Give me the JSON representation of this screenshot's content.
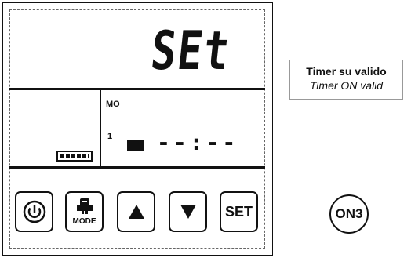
{
  "display": {
    "main_segment_text": "SEt",
    "mode_label": "MO",
    "row_number": "1",
    "time_text": "--:--"
  },
  "buttons": {
    "power_icon": "power-icon",
    "mode_label": "MODE",
    "up_icon": "triangle-up-icon",
    "down_icon": "triangle-down-icon",
    "set_label": "SET"
  },
  "note": {
    "title": "Timer su valido",
    "subtitle": "Timer ON valid"
  },
  "badge": {
    "label": "ON3"
  }
}
